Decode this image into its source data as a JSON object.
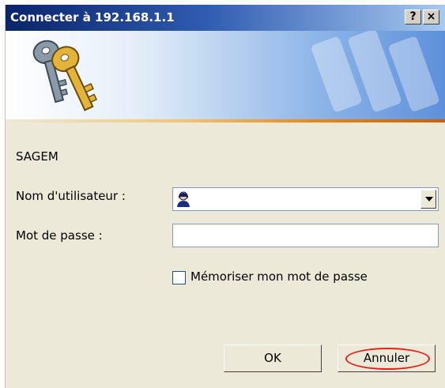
{
  "window": {
    "title": "Connecter à 192.168.1.1",
    "help_label": "?",
    "close_label": "×"
  },
  "banner": {
    "icon": "keys-icon",
    "watermark": "keys-watermark"
  },
  "form": {
    "realm": "SAGEM",
    "username_label": "Nom d'utilisateur :",
    "username_value": "",
    "password_label": "Mot de passe :",
    "password_value": "",
    "remember_label": "Mémoriser mon mot de passe",
    "remember_checked": false
  },
  "buttons": {
    "ok": "OK",
    "cancel": "Annuler"
  },
  "colors": {
    "title_start": "#0a246a",
    "title_end": "#a6caf0",
    "dialog_bg": "#ece9d8",
    "highlight": "#e8201a"
  }
}
